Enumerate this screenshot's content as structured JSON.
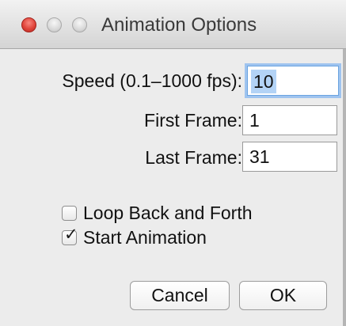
{
  "window": {
    "title": "Animation Options"
  },
  "fields": {
    "speed": {
      "label": "Speed (0.1–1000 fps):",
      "value": "10"
    },
    "first_frame": {
      "label": "First Frame:",
      "value": "1"
    },
    "last_frame": {
      "label": "Last Frame:",
      "value": "31"
    }
  },
  "options": {
    "loop_back_and_forth": {
      "label": "Loop Back and Forth",
      "checked": false
    },
    "start_animation": {
      "label": "Start Animation",
      "checked": true
    }
  },
  "buttons": {
    "cancel": "Cancel",
    "ok": "OK"
  },
  "colors": {
    "close_button": "#e0443a",
    "focus_ring": "#9fc4ef",
    "selection": "#b3d3f6"
  }
}
